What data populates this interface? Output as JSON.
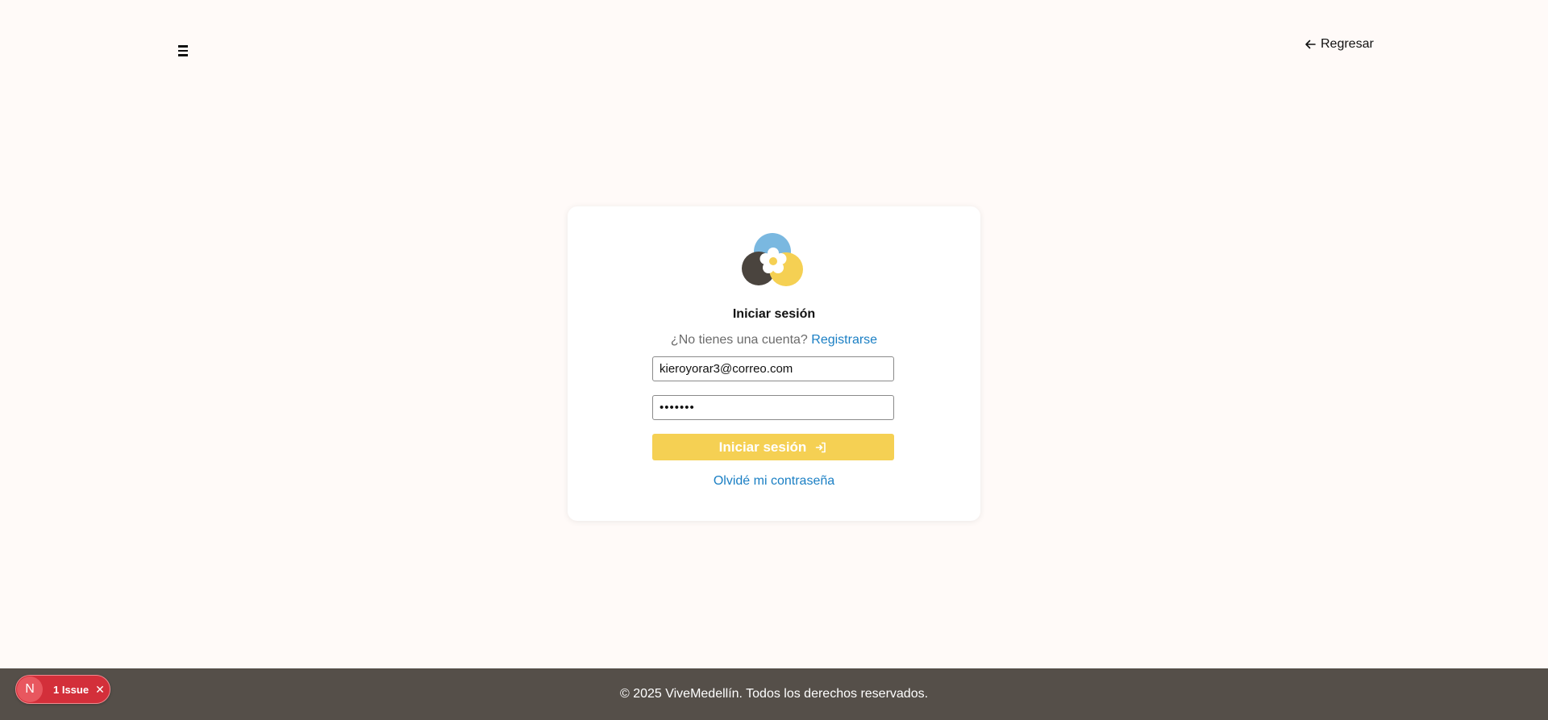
{
  "header": {
    "menu_icon": "hamburger-icon",
    "back_label": "Regresar",
    "back_icon": "arrow-left-icon"
  },
  "login": {
    "logo_icon": "vivemedellin-logo",
    "title": "Iniciar sesión",
    "signup_prompt": "¿No tienes una cuenta?",
    "signup_link": "Registrarse",
    "email_value": "kieroyorar3@correo.com",
    "password_value": "•••••••",
    "submit_label": "Iniciar sesión",
    "submit_icon": "log-in-icon",
    "forgot_label": "Olvidé mi contraseña"
  },
  "footer": {
    "text": "© 2025 ViveMedellín. Todos los derechos reservados."
  },
  "devtools": {
    "avatar_letter": "N",
    "issue_label": "1 Issue",
    "close_icon": "close-icon"
  },
  "colors": {
    "background": "#fffaf8",
    "accent_yellow": "#f5d053",
    "link_blue": "#1a7fc4",
    "footer_brown": "#554f49",
    "issue_red": "#d32f3a",
    "logo_blue": "#7ab8e0",
    "logo_dark": "#4a443e"
  }
}
